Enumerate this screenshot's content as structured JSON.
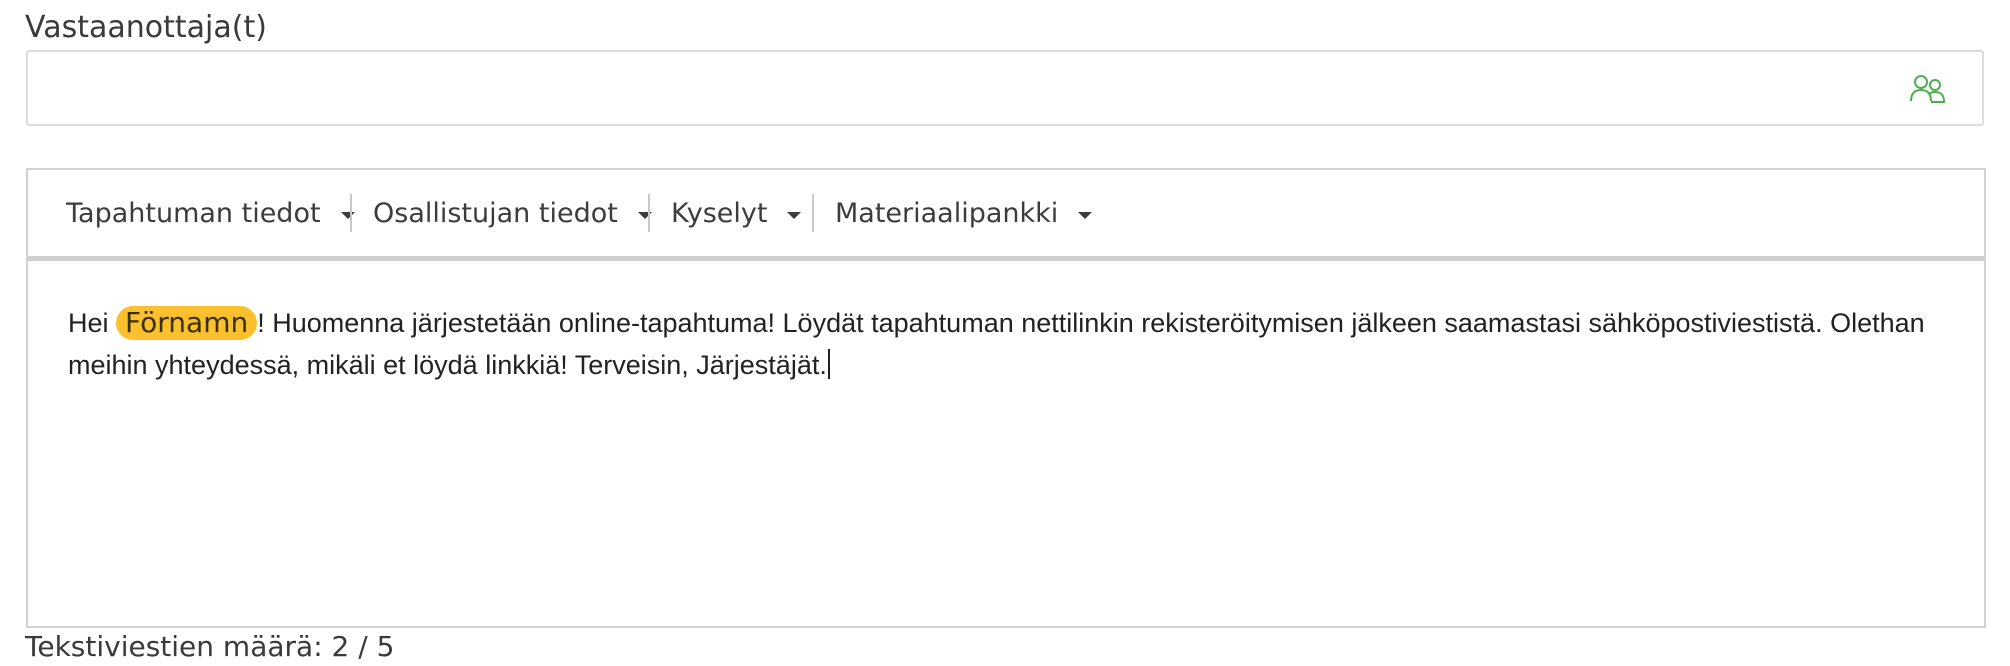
{
  "recipients": {
    "label": "Vastaanottaja(t)",
    "value": "",
    "placeholder": "",
    "icon": "people-icon",
    "icon_color": "#4caf50"
  },
  "toolbar": {
    "items": [
      {
        "label": "Tapahtuman tiedot"
      },
      {
        "label": "Osallistujan tiedot"
      },
      {
        "label": "Kyselyt"
      },
      {
        "label": "Materiaalipankki"
      }
    ]
  },
  "message": {
    "greeting": "Hei",
    "placeholder_chip": "Förnamn",
    "placeholder_color": "#fbc02d",
    "body": "! Huomenna järjestetään online-tapahtuma! Löydät tapahtuman nettilinkin rekisteröitymisen jälkeen saamastasi sähköpostiviestistä. Olethan meihin yhteydessä, mikäli et löydä linkkiä! Terveisin, Järjestäjät."
  },
  "footer": {
    "sms_count": "Tekstiviestien määrä: 2 / 5"
  }
}
